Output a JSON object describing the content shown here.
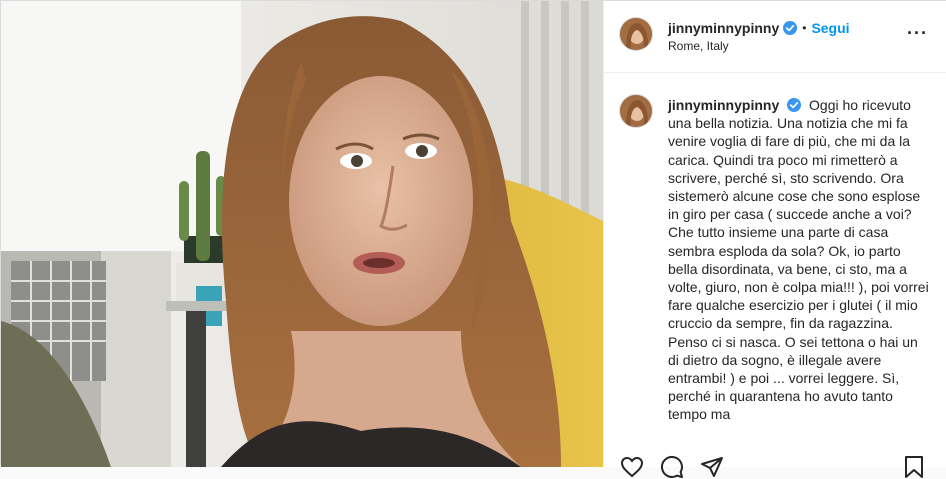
{
  "post": {
    "username": "jinnyminnypinny",
    "location": "Rome, Italy",
    "follow_label": "Segui",
    "dot": "•",
    "more": "···",
    "verified_color": "#3897f0",
    "accent_color": "#0095f6"
  },
  "caption": {
    "username": "jinnyminnypinny",
    "text": "Oggi ho ricevuto una bella notizia. Una notizia che mi fa venire voglia di fare di più, che mi da la carica. Quindi tra poco mi rimetterò a scrivere, perché sì, sto scrivendo. Ora sistemerò alcune cose che sono esplose in giro per casa ( succede anche a voi? Che tutto insieme una parte di casa sembra esploda da sola? Ok, io parto bella disordinata, va bene, ci sto, ma a volte, giuro, non è colpa mia!!! ), poi vorrei fare qualche esercizio per i glutei ( il mio cruccio da sempre, fin da ragazzina. Penso ci si nasca. O sei tettona o hai un di dietro da sogno, è illegale avere entrambi! ) e poi ... vorrei leggere. Sì, perché in quarantena ho avuto tanto tempo ma"
  },
  "actions": {
    "icons": [
      "heart-icon",
      "comment-icon",
      "share-icon",
      "bookmark-icon"
    ]
  }
}
